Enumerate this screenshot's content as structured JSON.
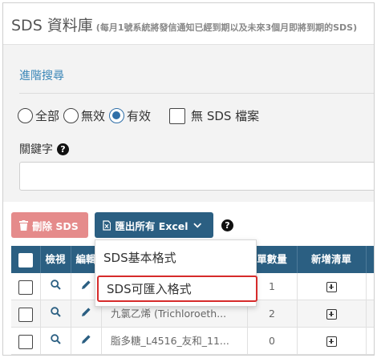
{
  "header": {
    "title": "SDS 資料庫",
    "subtitle": "(每月1號系統將發信通知已經到期以及未來3個月即將到期的SDS)"
  },
  "search": {
    "advanced_label": "進階搜尋",
    "status_options": [
      "全部",
      "無效",
      "有效"
    ],
    "selected_status": "有效",
    "no_sds_label": "無 SDS 檔案",
    "keyword_label": "關鍵字",
    "keyword_value": ""
  },
  "toolbar": {
    "delete_label": "刪除 SDS",
    "export_label": "匯出所有 Excel"
  },
  "export_menu": {
    "items": [
      "SDS基本格式",
      "SDS可匯入格式"
    ],
    "highlighted": "SDS可匯入格式"
  },
  "table": {
    "columns": [
      "檢視",
      "編輯",
      "單數量",
      "新增清單"
    ],
    "rows": [
      {
        "name": "",
        "quantity": "1"
      },
      {
        "name": "九氯乙烯 (Trichloroeth...",
        "quantity": "2"
      },
      {
        "name": "脂多糖_L4516_友和_11...",
        "quantity": "0"
      }
    ]
  },
  "colors": {
    "primary": "#2b5f82",
    "danger": "#e58b8b",
    "link": "#3a86b7",
    "highlight_border": "#d62b2b"
  }
}
